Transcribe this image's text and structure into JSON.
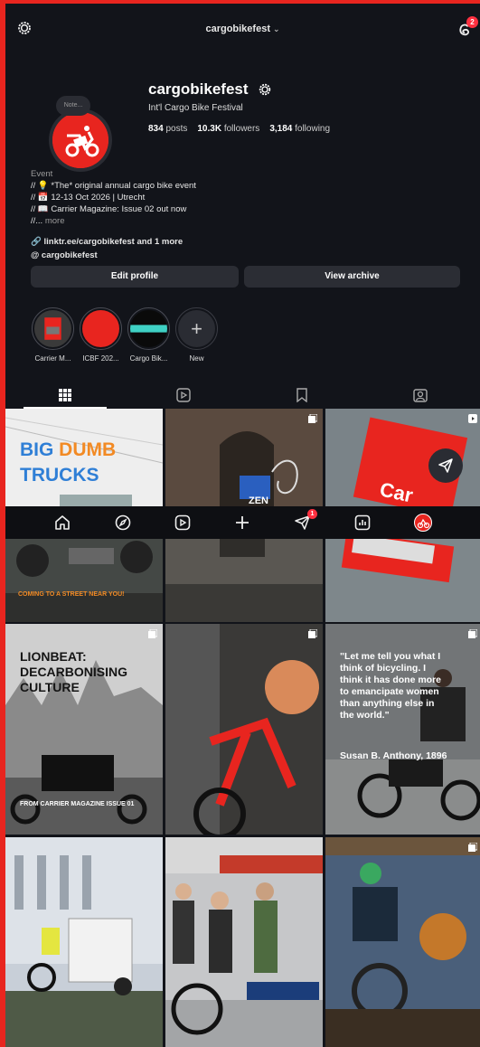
{
  "topbar": {
    "username": "cargobikefest",
    "threads_badge": "2"
  },
  "profile": {
    "note_label": "Note...",
    "name": "cargobikefest",
    "full_name": "Int'l Cargo Bike Festival",
    "posts_count": "834",
    "posts_label": "posts",
    "followers_count": "10.3K",
    "followers_label": "followers",
    "following_count": "3,184",
    "following_label": "following",
    "category": "Event",
    "bio_lines": [
      "// 💡 *The* original annual cargo bike event",
      "// 📅 12-13 Oct 2026 | Utrecht",
      "// 📖 Carrier Magazine: Issue 02 out now",
      "//..."
    ],
    "bio_more": "more",
    "link": "linktr.ee/cargobikefest and 1 more",
    "threads_handle": "cargobikefest",
    "edit_profile_label": "Edit profile",
    "view_archive_label": "View archive"
  },
  "highlights": [
    {
      "label": "Carrier M...",
      "color": "#e8251f"
    },
    {
      "label": "ICBF 202...",
      "color": "#e8251f"
    },
    {
      "label": "Cargo Bik...",
      "color": "#0a0a0a"
    },
    {
      "label": "New",
      "color": "#2a2c33"
    }
  ],
  "posts": {
    "tile1_line1_a": "BIG ",
    "tile1_line1_b": "DUMB",
    "tile1_line2": "TRUCKS",
    "tile4_caption": "COMING TO A STREET NEAR YOU!",
    "tile7_title": "LIONBEAT: DECARBONISING CULTURE",
    "tile7_caption": "FROM CARRIER MAGAZINE ISSUE 01",
    "tile9_quote": "\"Let me tell you what I think of bicycling. I think it has done more to emancipate women than anything else in the world.\"",
    "tile9_author": "Susan B. Anthony, 1896",
    "tile3_book_text": "Car",
    "tile2_sign": "ZEN"
  },
  "navbar": {
    "activity_badge": "1"
  },
  "colors": {
    "accent": "#e8251f",
    "background": "#12141a",
    "badge": "#ff3040"
  }
}
